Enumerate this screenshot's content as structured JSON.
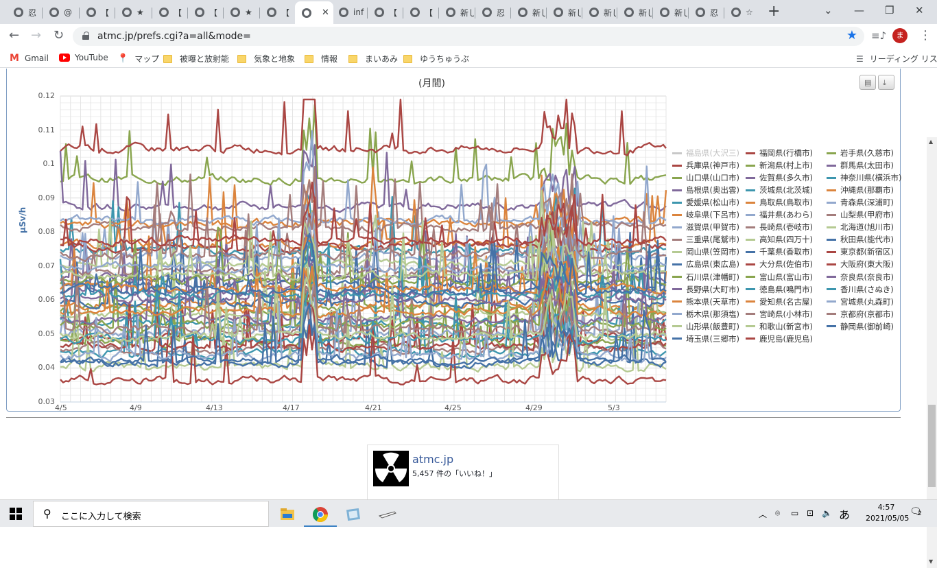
{
  "browser": {
    "tabs": [
      {
        "label": "忍",
        "active": false
      },
      {
        "label": "@",
        "active": false
      },
      {
        "label": "【",
        "active": false
      },
      {
        "label": "★",
        "active": false
      },
      {
        "label": "【",
        "active": false
      },
      {
        "label": "【",
        "active": false
      },
      {
        "label": "★",
        "active": false
      },
      {
        "label": "【",
        "active": false
      },
      {
        "label": "",
        "active": true
      },
      {
        "label": "inf",
        "active": false
      },
      {
        "label": "【",
        "active": false
      },
      {
        "label": "【",
        "active": false
      },
      {
        "label": "新しい",
        "active": false
      },
      {
        "label": "忍",
        "active": false
      },
      {
        "label": "新しい",
        "active": false
      },
      {
        "label": "新しい",
        "active": false
      },
      {
        "label": "新しい",
        "active": false
      },
      {
        "label": "新しい",
        "active": false
      },
      {
        "label": "新しい",
        "active": false
      },
      {
        "label": "忍",
        "active": false
      },
      {
        "label": "☆",
        "active": false
      }
    ],
    "active_tab_close": "✕",
    "new_tab": "+",
    "url": "atmc.jp/prefs.cgi?a=all&mode=",
    "profile_initial": "ま",
    "bookmarks": [
      {
        "label": "Gmail",
        "icon": "gmail-icon"
      },
      {
        "label": "YouTube",
        "icon": "youtube-icon"
      },
      {
        "label": "マップ",
        "icon": "maps-icon"
      },
      {
        "label": "被曝と放射能",
        "icon": "folder-icon"
      },
      {
        "label": "気象と地象",
        "icon": "folder-icon"
      },
      {
        "label": "情報",
        "icon": "folder-icon"
      },
      {
        "label": "まいあみ",
        "icon": "folder-icon"
      },
      {
        "label": "ゆうちゅうぶ",
        "icon": "folder-icon"
      }
    ],
    "reading_list": "リーディング リスト"
  },
  "chart_data": {
    "type": "line",
    "title": "(月間)",
    "ylabel": "µSv/h",
    "xlabel": "",
    "ylim": [
      0.03,
      0.12
    ],
    "yticks": [
      "0.12",
      "0.11",
      "0.1",
      "0.09",
      "0.08",
      "0.07",
      "0.06",
      "0.05",
      "0.04",
      "0.03"
    ],
    "xticks": [
      "4/5",
      "4/9",
      "4/13",
      "4/17",
      "4/21",
      "4/25",
      "4/29",
      "5/3"
    ],
    "grid": true,
    "legend_position": "right",
    "series": [
      {
        "name": "福島県(大沢三)",
        "color": "#c8c8c8",
        "base": 0.0,
        "hidden": true
      },
      {
        "name": "福岡県(行橋市)",
        "color": "#aa4643",
        "base": 0.049
      },
      {
        "name": "岩手県(久慈市)",
        "color": "#89a54e",
        "base": 0.0955
      },
      {
        "name": "兵庫県(神戸市)",
        "color": "#aa4643",
        "base": 0.1045
      },
      {
        "name": "新潟県(村上市)",
        "color": "#89a54e",
        "base": 0.0475
      },
      {
        "name": "群馬県(太田市)",
        "color": "#80699b",
        "base": 0.0875
      },
      {
        "name": "山口県(山口市)",
        "color": "#89a54e",
        "base": 0.0575
      },
      {
        "name": "佐賀県(多久市)",
        "color": "#80699b",
        "base": 0.0625
      },
      {
        "name": "神奈川県(横浜市)",
        "color": "#3d96ae",
        "base": 0.0745
      },
      {
        "name": "島根県(奥出雲)",
        "color": "#80699b",
        "base": 0.0665
      },
      {
        "name": "茨城県(北茨城)",
        "color": "#3d96ae",
        "base": 0.0535
      },
      {
        "name": "沖縄県(那覇市)",
        "color": "#db843d",
        "base": 0.0765
      },
      {
        "name": "愛媛県(松山市)",
        "color": "#3d96ae",
        "base": 0.0445
      },
      {
        "name": "鳥取県(鳥取市)",
        "color": "#db843d",
        "base": 0.0585
      },
      {
        "name": "青森県(深浦町)",
        "color": "#92a8cd",
        "base": 0.0725
      },
      {
        "name": "岐阜県(下呂市)",
        "color": "#db843d",
        "base": 0.0825
      },
      {
        "name": "福井県(あわら)",
        "color": "#92a8cd",
        "base": 0.0505
      },
      {
        "name": "山梨県(甲府市)",
        "color": "#a47d7c",
        "base": 0.0455
      },
      {
        "name": "滋賀県(甲賀市)",
        "color": "#92a8cd",
        "base": 0.0835
      },
      {
        "name": "長崎県(壱岐市)",
        "color": "#a47d7c",
        "base": 0.0685
      },
      {
        "name": "北海道(旭川市)",
        "color": "#b5ca92",
        "base": 0.0405
      },
      {
        "name": "三重県(尾鷲市)",
        "color": "#a47d7c",
        "base": 0.0815
      },
      {
        "name": "高知県(四万十)",
        "color": "#b5ca92",
        "base": 0.0555
      },
      {
        "name": "秋田県(能代市)",
        "color": "#4572a7",
        "base": 0.0645
      },
      {
        "name": "岡山県(笠岡市)",
        "color": "#b5ca92",
        "base": 0.0705
      },
      {
        "name": "千葉県(香取市)",
        "color": "#4572a7",
        "base": 0.0415
      },
      {
        "name": "東京都(新宿区)",
        "color": "#aa4643",
        "base": 0.0365
      },
      {
        "name": "広島県(東広島)",
        "color": "#4572a7",
        "base": 0.0595
      },
      {
        "name": "大分県(佐伯市)",
        "color": "#aa4643",
        "base": 0.0755
      },
      {
        "name": "大阪府(東大阪)",
        "color": "#aa4643",
        "base": 0.0465
      },
      {
        "name": "石川県(津幡町)",
        "color": "#89a54e",
        "base": 0.0655
      },
      {
        "name": "富山県(富山市)",
        "color": "#89a54e",
        "base": 0.0525
      },
      {
        "name": "奈良県(奈良市)",
        "color": "#80699b",
        "base": 0.0605
      },
      {
        "name": "長野県(大町市)",
        "color": "#80699b",
        "base": 0.0545
      },
      {
        "name": "徳島県(鳴門市)",
        "color": "#3d96ae",
        "base": 0.0485
      },
      {
        "name": "香川県(さぬき)",
        "color": "#3d96ae",
        "base": 0.0615
      },
      {
        "name": "熊本県(天草市)",
        "color": "#db843d",
        "base": 0.0565
      },
      {
        "name": "愛知県(名古屋)",
        "color": "#db843d",
        "base": 0.0635
      },
      {
        "name": "宮城県(丸森町)",
        "color": "#92a8cd",
        "base": 0.0435
      },
      {
        "name": "栃木県(那須塩)",
        "color": "#92a8cd",
        "base": 0.0695
      },
      {
        "name": "宮崎県(小林市)",
        "color": "#a47d7c",
        "base": 0.0515
      },
      {
        "name": "京都府(京都市)",
        "color": "#a47d7c",
        "base": 0.0735
      },
      {
        "name": "山形県(飯豊町)",
        "color": "#b5ca92",
        "base": 0.0675
      },
      {
        "name": "和歌山(新宮市)",
        "color": "#b5ca92",
        "base": 0.0495
      },
      {
        "name": "静岡県(御前崎)",
        "color": "#4572a7",
        "base": 0.0425
      },
      {
        "name": "埼玉県(三郷市)",
        "color": "#4572a7",
        "base": 0.0625
      },
      {
        "name": "鹿児島(鹿児島)",
        "color": "#aa4643",
        "base": 0.0775
      }
    ]
  },
  "fb_widget": {
    "name": "atmc.jp",
    "likes": "5,457 件の「いいね！」"
  },
  "taskbar": {
    "search_placeholder": "ここに入力して検索",
    "ime": "あ",
    "time": "4:57",
    "date": "2021/05/05",
    "notifications": "2"
  }
}
